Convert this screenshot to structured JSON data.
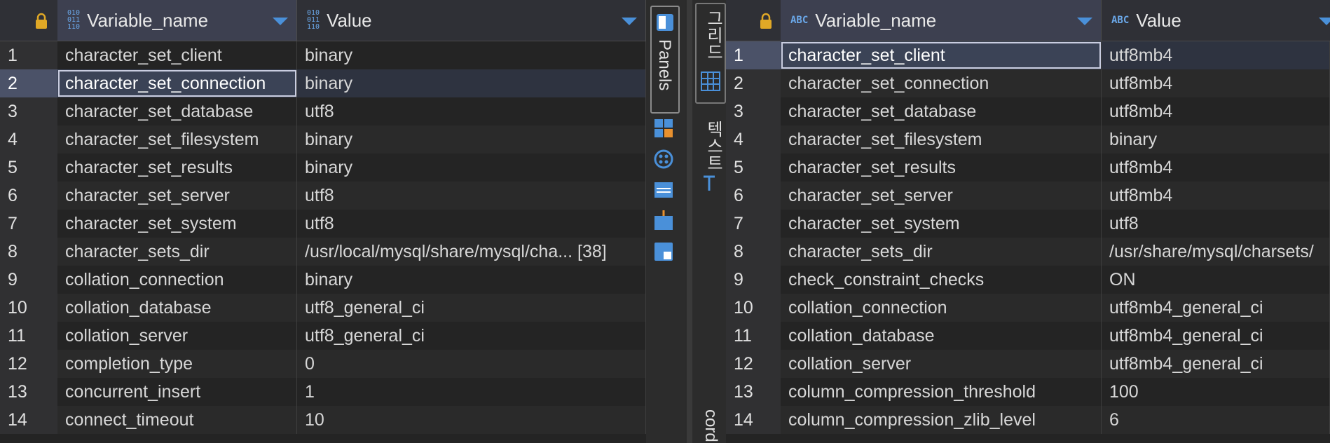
{
  "left_grid": {
    "columns": [
      {
        "label": "Variable_name",
        "type_icon": "010\n011\n110"
      },
      {
        "label": "Value",
        "type_icon": "010\n011\n110"
      }
    ],
    "rows": [
      {
        "num": "1",
        "name": "character_set_client",
        "value": "binary"
      },
      {
        "num": "2",
        "name": "character_set_connection",
        "value": "binary"
      },
      {
        "num": "3",
        "name": "character_set_database",
        "value": "utf8"
      },
      {
        "num": "4",
        "name": "character_set_filesystem",
        "value": "binary"
      },
      {
        "num": "5",
        "name": "character_set_results",
        "value": "binary"
      },
      {
        "num": "6",
        "name": "character_set_server",
        "value": "utf8"
      },
      {
        "num": "7",
        "name": "character_set_system",
        "value": "utf8"
      },
      {
        "num": "8",
        "name": "character_sets_dir",
        "value": "/usr/local/mysql/share/mysql/cha... [38]"
      },
      {
        "num": "9",
        "name": "collation_connection",
        "value": "binary"
      },
      {
        "num": "10",
        "name": "collation_database",
        "value": "utf8_general_ci"
      },
      {
        "num": "11",
        "name": "collation_server",
        "value": "utf8_general_ci"
      },
      {
        "num": "12",
        "name": "completion_type",
        "value": "0"
      },
      {
        "num": "13",
        "name": "concurrent_insert",
        "value": "1"
      },
      {
        "num": "14",
        "name": "connect_timeout",
        "value": "10"
      }
    ]
  },
  "left_toolbar": {
    "panels_label": "Panels"
  },
  "right_toolbar": {
    "grid_tab": "그리드",
    "text_tab": "텍스트",
    "record_tab": "cord"
  },
  "right_grid": {
    "columns": [
      {
        "label": "Variable_name",
        "type_icon": "ABC"
      },
      {
        "label": "Value",
        "type_icon": "ABC"
      }
    ],
    "rows": [
      {
        "num": "1",
        "name": "character_set_client",
        "value": "utf8mb4"
      },
      {
        "num": "2",
        "name": "character_set_connection",
        "value": "utf8mb4"
      },
      {
        "num": "3",
        "name": "character_set_database",
        "value": "utf8mb4"
      },
      {
        "num": "4",
        "name": "character_set_filesystem",
        "value": "binary"
      },
      {
        "num": "5",
        "name": "character_set_results",
        "value": "utf8mb4"
      },
      {
        "num": "6",
        "name": "character_set_server",
        "value": "utf8mb4"
      },
      {
        "num": "7",
        "name": "character_set_system",
        "value": "utf8"
      },
      {
        "num": "8",
        "name": "character_sets_dir",
        "value": "/usr/share/mysql/charsets/"
      },
      {
        "num": "9",
        "name": "check_constraint_checks",
        "value": "ON"
      },
      {
        "num": "10",
        "name": "collation_connection",
        "value": "utf8mb4_general_ci"
      },
      {
        "num": "11",
        "name": "collation_database",
        "value": "utf8mb4_general_ci"
      },
      {
        "num": "12",
        "name": "collation_server",
        "value": "utf8mb4_general_ci"
      },
      {
        "num": "13",
        "name": "column_compression_threshold",
        "value": "100"
      },
      {
        "num": "14",
        "name": "column_compression_zlib_level",
        "value": "6"
      }
    ]
  },
  "colors": {
    "accent": "#4a90d9",
    "selection": "#3b4356"
  }
}
